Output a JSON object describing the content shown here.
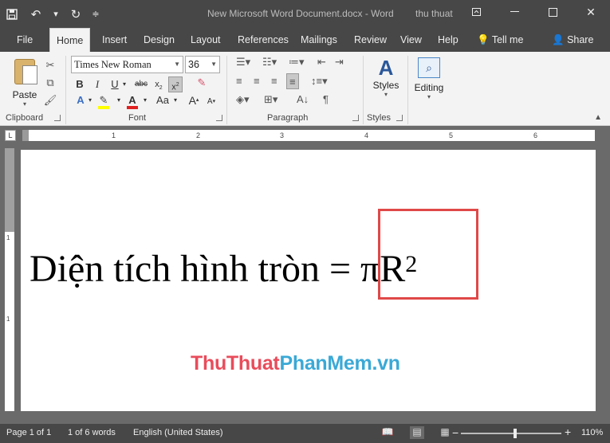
{
  "titlebar": {
    "title": "New Microsoft Word Document.docx  -  Word",
    "user": "thu thuat"
  },
  "tabs": [
    "File",
    "Home",
    "Insert",
    "Design",
    "Layout",
    "References",
    "Mailings",
    "Review",
    "View",
    "Help",
    "Tell me",
    "Share"
  ],
  "ribbon": {
    "clipboard": {
      "paste_label": "Paste",
      "group_label": "Clipboard"
    },
    "font": {
      "name": "Times New Roman",
      "size": "36",
      "group_label": "Font"
    },
    "paragraph": {
      "group_label": "Paragraph"
    },
    "styles": {
      "label": "Styles",
      "group_label": "Styles"
    },
    "editing": {
      "label": "Editing"
    }
  },
  "ruler": {
    "numbers": [
      "1",
      "2",
      "3",
      "4",
      "5",
      "6"
    ]
  },
  "vruler": {
    "numbers": [
      "1",
      "1"
    ]
  },
  "document": {
    "text_main": "Diện tích hình tròn = πR",
    "superscript": "2"
  },
  "watermark": {
    "part1": "ThuThuat",
    "part2": "PhanMem",
    "part3": ".vn"
  },
  "statusbar": {
    "page": "Page 1 of 1",
    "words": "1 of 6 words",
    "language": "English (United States)",
    "zoom": "110%"
  }
}
